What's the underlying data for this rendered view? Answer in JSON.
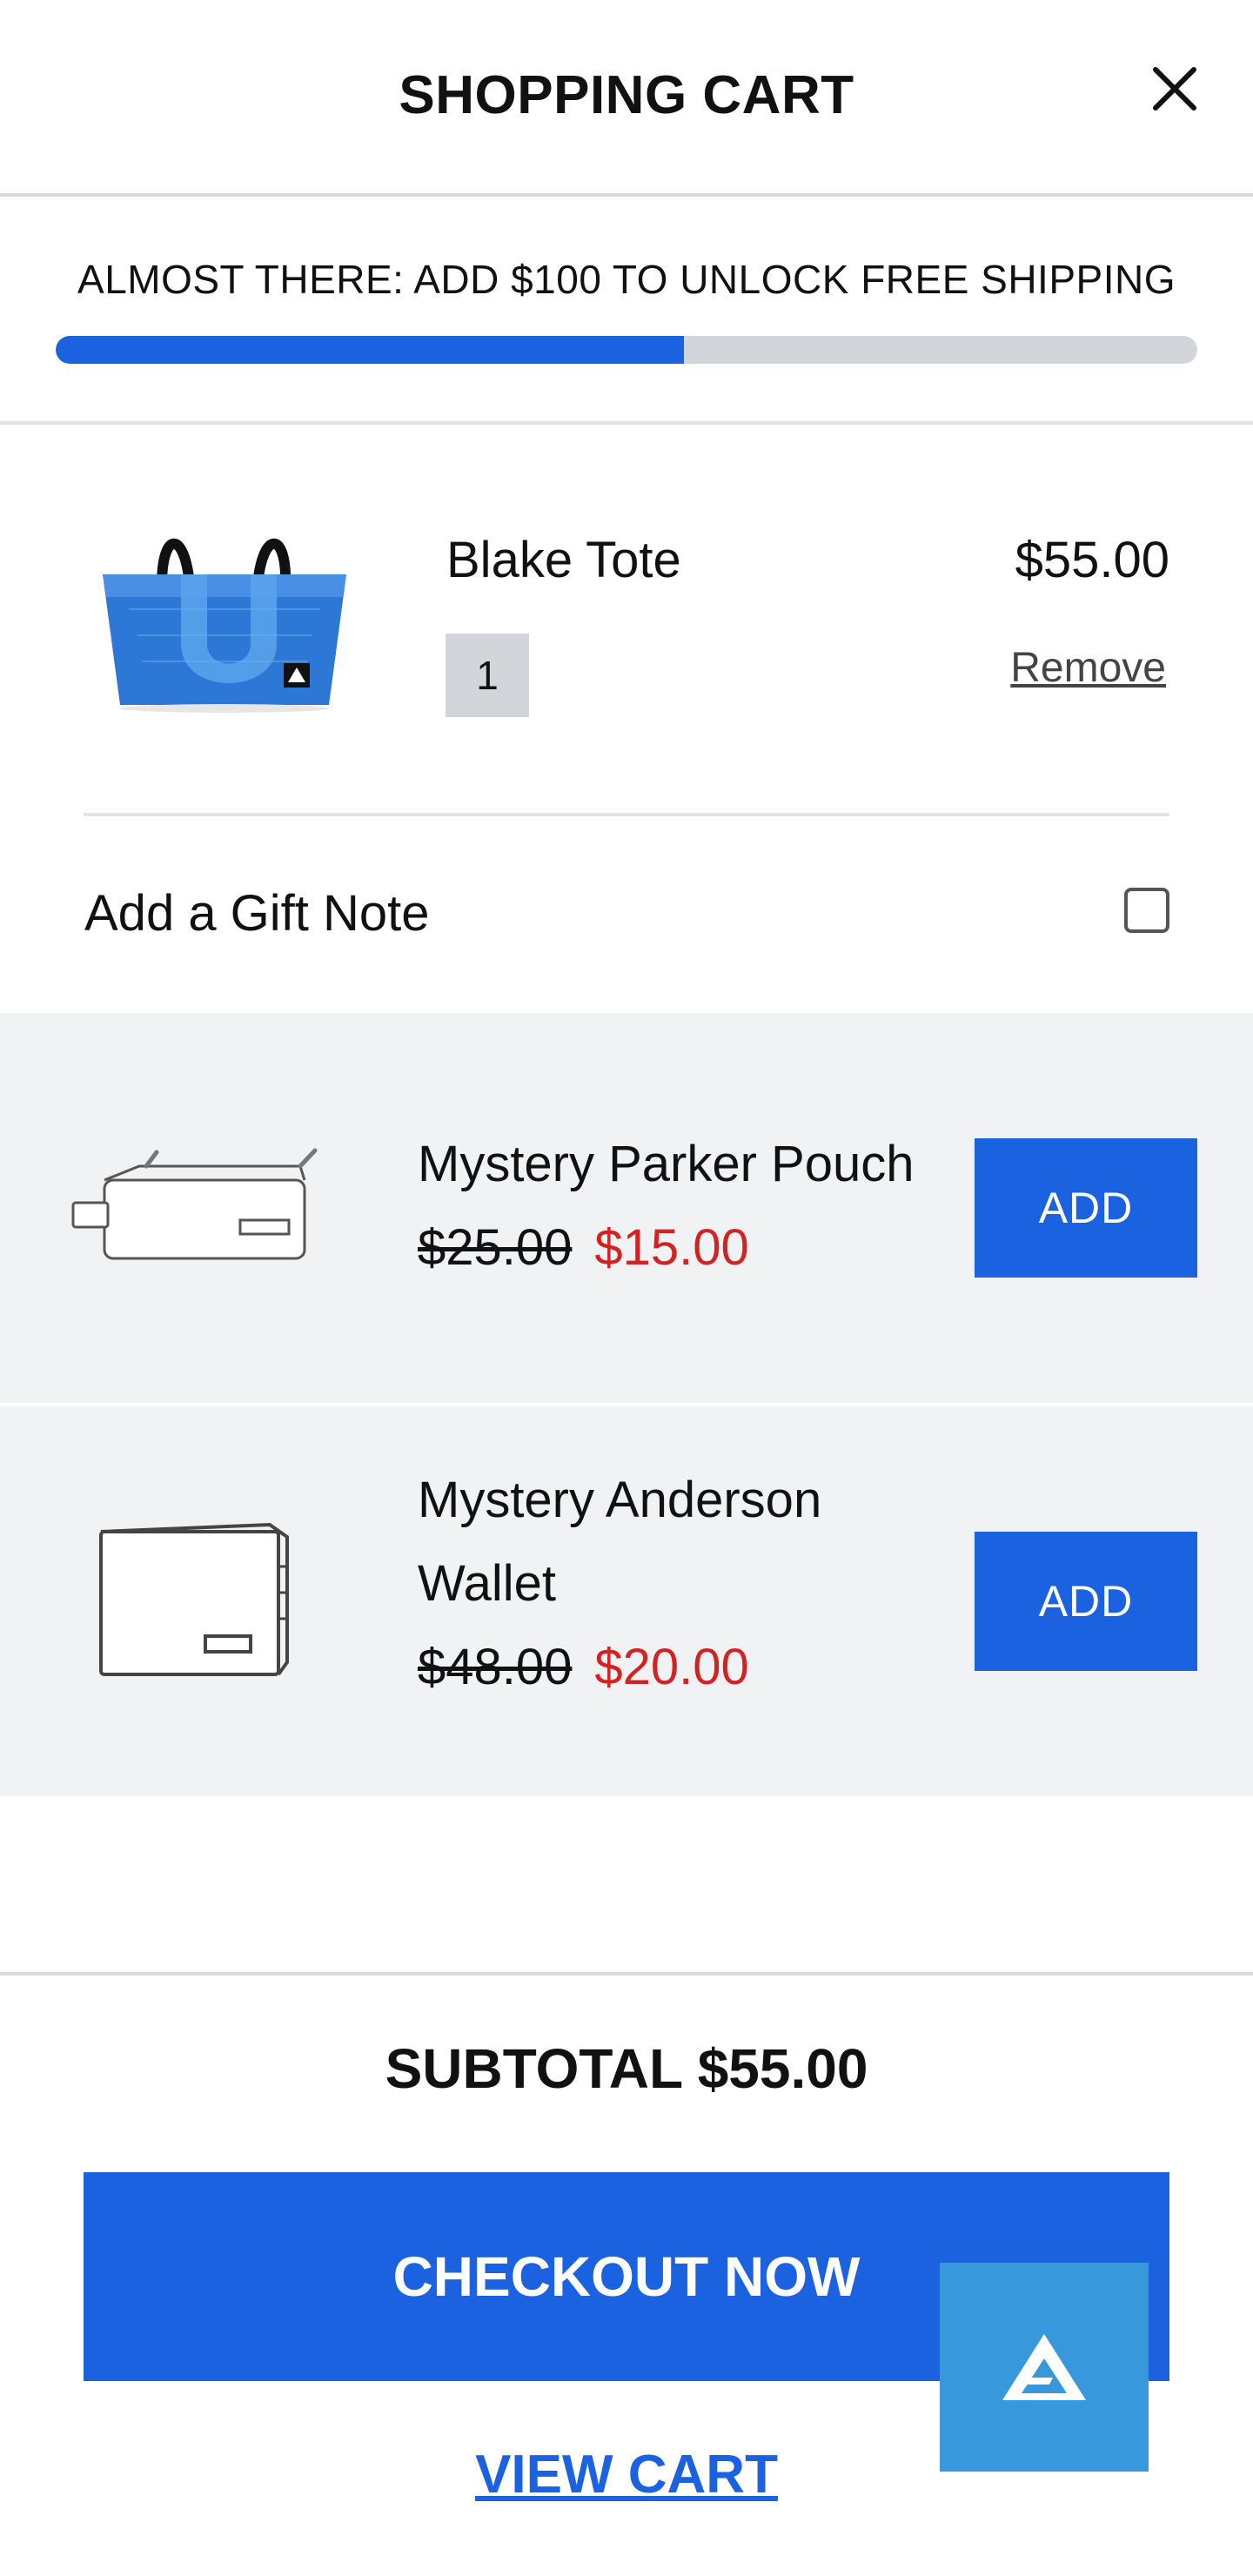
{
  "header": {
    "title": "SHOPPING CART",
    "close_icon": "close-icon"
  },
  "shipping": {
    "message": "ALMOST THERE: ADD $100 TO UNLOCK FREE SHIPPING",
    "progress_percent": 55
  },
  "cart_item": {
    "name": "Blake Tote",
    "price": "$55.00",
    "quantity": "1",
    "remove_label": "Remove"
  },
  "gift_note": {
    "label": "Add a Gift Note",
    "checked": false
  },
  "upsells": [
    {
      "name": "Mystery Parker Pouch",
      "old_price": "$25.00",
      "new_price": "$15.00",
      "button": "ADD"
    },
    {
      "name": "Mystery Anderson Wallet",
      "old_price": "$48.00",
      "new_price": "$20.00",
      "button": "ADD"
    }
  ],
  "footer": {
    "subtotal": "SUBTOTAL $55.00",
    "checkout": "CHECKOUT NOW",
    "view_cart": "VIEW CART"
  },
  "colors": {
    "accent": "#1a62e0",
    "sale": "#d32222",
    "chat": "#3799dc"
  }
}
